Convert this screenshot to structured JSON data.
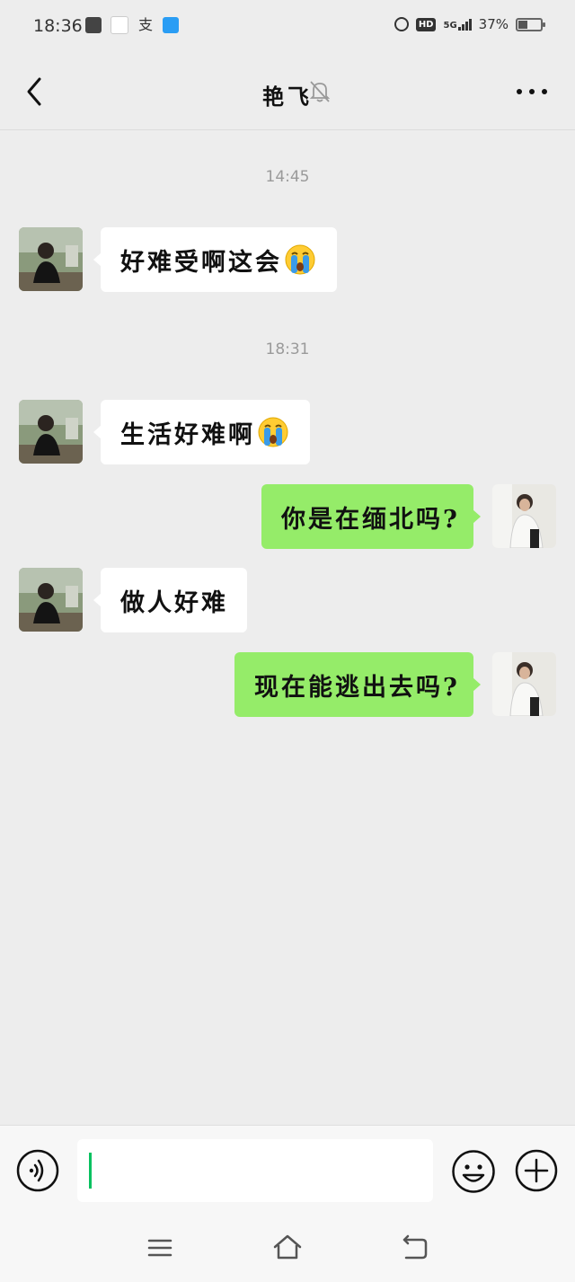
{
  "status_bar": {
    "time": "18:36",
    "alipay_glyph": "支",
    "hd_label": "HD",
    "network_label": "5G",
    "battery_percent": "37%",
    "battery_level": 0.37
  },
  "header": {
    "title": "艳飞",
    "back_icon": "chevron-left-icon",
    "mute_icon": "bell-off-icon",
    "more_icon": "more-horizontal-icon"
  },
  "chat": {
    "timestamps": [
      "14:45",
      "18:31"
    ],
    "messages": [
      {
        "side": "incoming",
        "text": "好难受啊这会",
        "emoji": "loudly-crying-face"
      },
      {
        "side": "incoming",
        "text": "生活好难啊",
        "emoji": "loudly-crying-face"
      },
      {
        "side": "outgoing",
        "text": "你是在缅北吗?"
      },
      {
        "side": "incoming",
        "text": "做人好难"
      },
      {
        "side": "outgoing",
        "text": "现在能逃出去吗?"
      }
    ]
  },
  "input_bar": {
    "value": "",
    "voice_icon": "voice-icon",
    "emoji_icon": "smiley-icon",
    "plus_icon": "plus-circle-icon",
    "cursor_color": "#07c160"
  },
  "colors": {
    "background": "#ededed",
    "incoming_bubble": "#ffffff",
    "outgoing_bubble": "#95ec69"
  },
  "nav_bar": {
    "menu_icon": "menu-icon",
    "home_icon": "home-icon",
    "back_icon": "back-icon"
  }
}
